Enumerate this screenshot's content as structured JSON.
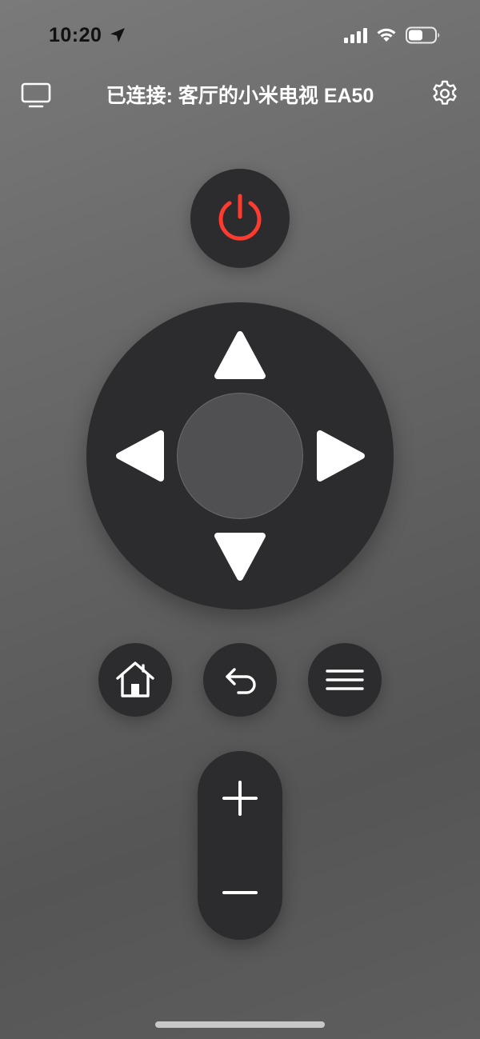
{
  "status_bar": {
    "time": "10:20",
    "icons": [
      "location-arrow-icon",
      "cellular-signal-icon",
      "wifi-icon",
      "battery-icon"
    ]
  },
  "header": {
    "title": "已连接: 客厅的小米电视 EA50",
    "left_icon": "tv-icon",
    "right_icon": "gear-icon"
  },
  "remote": {
    "power_icon": "power-icon",
    "power_color": "#ff3b30",
    "dpad_icons": [
      "arrow-up-icon",
      "arrow-down-icon",
      "arrow-left-icon",
      "arrow-right-icon"
    ],
    "buttons": [
      {
        "name": "home",
        "icon": "home-icon"
      },
      {
        "name": "back",
        "icon": "back-arrow-icon"
      },
      {
        "name": "menu",
        "icon": "menu-icon"
      }
    ],
    "volume": {
      "up_icon": "plus-icon",
      "down_icon": "minus-icon"
    }
  },
  "colors": {
    "button_fill": "#2c2c2e",
    "ok_fill": "#505052",
    "icon": "#ffffff"
  }
}
